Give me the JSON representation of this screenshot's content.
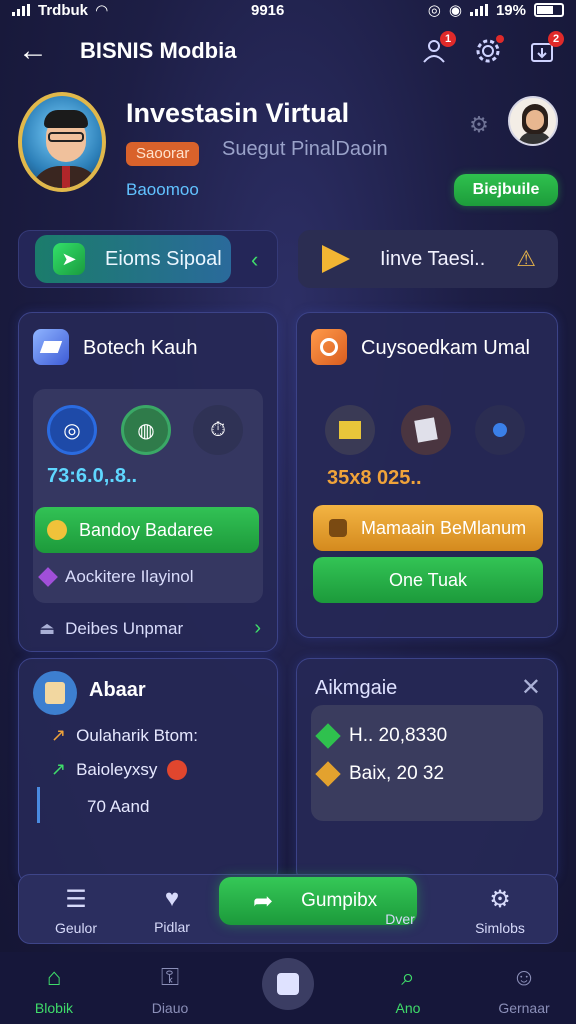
{
  "status_bar": {
    "left_text": "Trdbuk",
    "time": "9916",
    "battery": "19%"
  },
  "header": {
    "title": "BISNIS Modbia",
    "notif_count_1": "1",
    "notif_count_2": "2"
  },
  "profile": {
    "name": "Investasin Virtual",
    "badge": "Saoorar",
    "subtitle": "Suegut PinalDaoin",
    "id_text": "Baoomoo",
    "action_button": "Biejbuile"
  },
  "tabs": {
    "left_label": "Eioms Sipoal",
    "right_label": "Iinve Taesi.."
  },
  "card_left": {
    "title": "Botech Kauh",
    "value": "73:6.0,.8..",
    "green_button": "Bandoy Badaree",
    "note": "Aockitere Ilayinol",
    "footer": "Deibes Unpmar"
  },
  "card_right": {
    "title": "Cuysoedkam Umal",
    "value": "35x8 025..",
    "orange_button": "Mamaain BeMlanum",
    "green_button": "One Tuak"
  },
  "card_bottom_left": {
    "title": "Abaar",
    "line1": "Oulaharik Btom:",
    "line2": "Baioleyxsy",
    "line3": "70 Aand"
  },
  "card_bottom_right": {
    "title": "Aikmgaie",
    "row1": "H.. 20,8330",
    "row2": "Baix, 20 32"
  },
  "bottom_actions": {
    "item1": "Geulor",
    "item2": "Pidlar",
    "center": "Gumpibx",
    "item4": "Dver",
    "item5": "Simlobs"
  },
  "tabbar": {
    "tab1": "Blobik",
    "tab2": "Diauo",
    "tab4": "Ano",
    "tab5": "Gernaar"
  },
  "colors": {
    "background": "#1d1e45",
    "accent_green": "#2fc14e",
    "accent_orange": "#e3a22e",
    "badge_red": "#e02a2a",
    "link_blue": "#61c2ff"
  }
}
